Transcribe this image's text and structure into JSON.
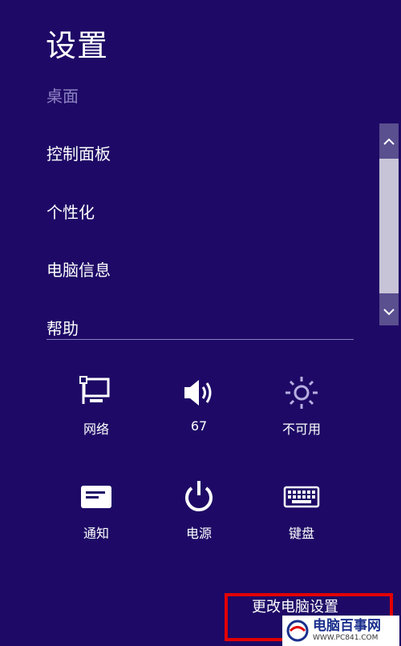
{
  "header": {
    "title": "设置",
    "subtitle": "桌面"
  },
  "menu": [
    {
      "label": "控制面板"
    },
    {
      "label": "个性化"
    },
    {
      "label": "电脑信息"
    },
    {
      "label": "帮助"
    }
  ],
  "quick_settings": [
    {
      "icon": "network-icon",
      "label": "网络"
    },
    {
      "icon": "volume-icon",
      "label": "67"
    },
    {
      "icon": "brightness-icon",
      "label": "不可用"
    },
    {
      "icon": "notifications-icon",
      "label": "通知"
    },
    {
      "icon": "power-icon",
      "label": "电源"
    },
    {
      "icon": "keyboard-icon",
      "label": "键盘"
    }
  ],
  "footer": {
    "change_pc_settings": "更改电脑设置"
  },
  "watermark": {
    "main": "电脑百事网",
    "url": "WWW.PC841.COM"
  },
  "colors": {
    "background": "#1e0a66",
    "highlight": "#e30000"
  }
}
